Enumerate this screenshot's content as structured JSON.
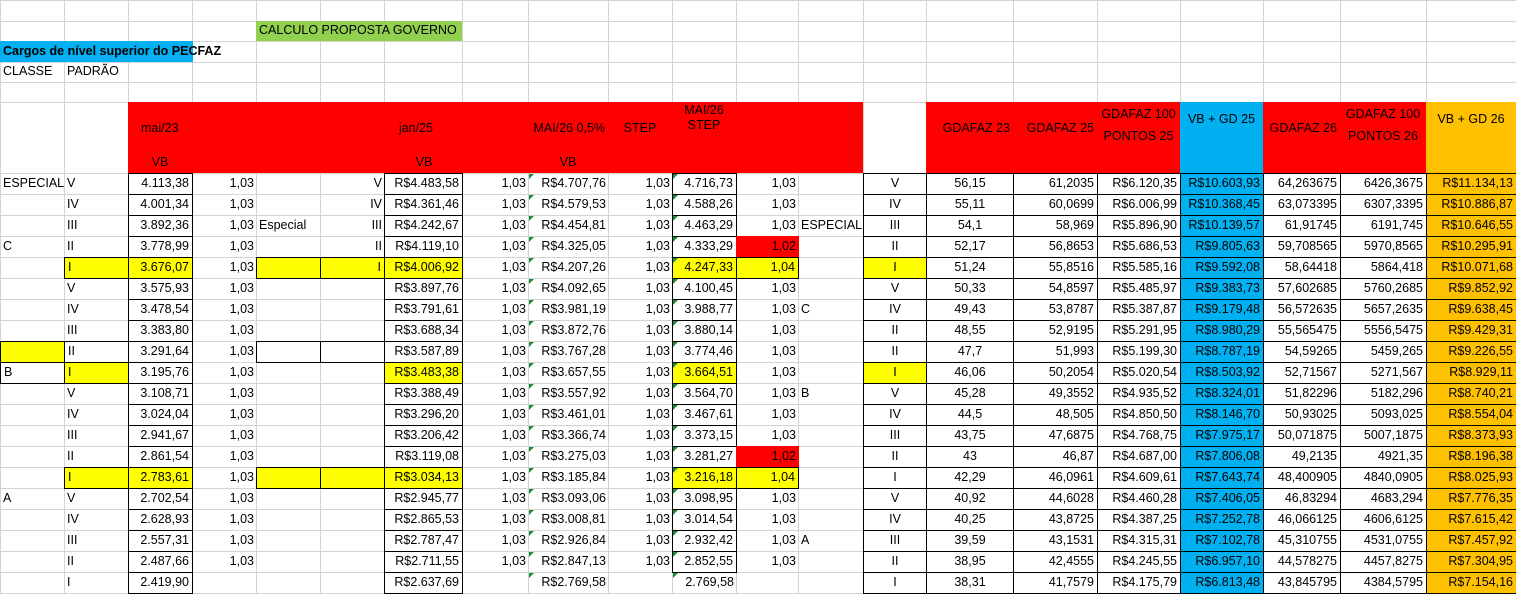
{
  "colors": {
    "red": "#ff0000",
    "yellow": "#ffff00",
    "cyan": "#00b0f0",
    "orange": "#ffc000",
    "green": "#92d050",
    "grid": "#d4d4d4"
  },
  "top": {
    "calc_title": "CALCULO PROPOSTA GOVERNO",
    "cargos": "Cargos de nível superior do PECFAZ",
    "classe": "CLASSE",
    "padrao": "PADRÃO"
  },
  "headers": {
    "mai23": "mai/23",
    "vb1": "VB",
    "jan25": "jan/25",
    "vb2": "VB",
    "mai26_05": "MAI/26 0,5%",
    "vb3": "VB",
    "step": "STEP",
    "mai26_step_1": "MAI/26",
    "mai26_step_2": "STEP",
    "gdafaz23": "GDAFAZ 23",
    "gdafaz25": "GDAFAZ 25",
    "gdafaz100_25_1": "GDAFAZ 100",
    "gdafaz100_25_2": "PONTOS 25",
    "vbgd25": "VB + GD 25",
    "gdafaz26": "GDAFAZ 26",
    "gdafaz100_26_1": "GDAFAZ 100",
    "gdafaz100_26_2": "PONTOS 26",
    "vbgd26": "VB + GD 26"
  },
  "rows": [
    {
      "classe": "ESPECIAL",
      "padrao": "V",
      "v23": "4.113,38",
      "f1": "1,03",
      "ca": "",
      "pa": "V",
      "jan25": "R$4.483,58",
      "f2": "1,03",
      "mai26": "R$4.707,76",
      "f3": "1,03",
      "step": "4.716,73",
      "f4": "1,03",
      "cb": "",
      "pb": "V",
      "g23": "56,15",
      "g25": "61,2035",
      "gp25": "R$6.120,35",
      "vb25": "R$10.603,93",
      "g26": "64,263675",
      "gp26": "6426,3675",
      "vb26": "R$11.134,13"
    },
    {
      "classe": "",
      "padrao": "IV",
      "v23": "4.001,34",
      "f1": "1,03",
      "ca": "",
      "pa": "IV",
      "jan25": "R$4.361,46",
      "f2": "1,03",
      "mai26": "R$4.579,53",
      "f3": "1,03",
      "step": "4.588,26",
      "f4": "1,03",
      "cb": "",
      "pb": "IV",
      "g23": "55,11",
      "g25": "60,0699",
      "gp25": "R$6.006,99",
      "vb25": "R$10.368,45",
      "g26": "63,073395",
      "gp26": "6307,3395",
      "vb26": "R$10.886,87"
    },
    {
      "classe": "",
      "padrao": "III",
      "v23": "3.892,36",
      "f1": "1,03",
      "ca": "Especial",
      "pa": "III",
      "jan25": "R$4.242,67",
      "f2": "1,03",
      "mai26": "R$4.454,81",
      "f3": "1,03",
      "step": "4.463,29",
      "f4": "1,03",
      "cb": "ESPECIAL",
      "pb": "III",
      "g23": "54,1",
      "g25": "58,969",
      "gp25": "R$5.896,90",
      "vb25": "R$10.139,57",
      "g26": "61,91745",
      "gp26": "6191,745",
      "vb26": "R$10.646,55"
    },
    {
      "classe": "C",
      "padrao": "II",
      "v23": "3.778,99",
      "f1": "1,03",
      "ca": "",
      "pa": "II",
      "jan25": "R$4.119,10",
      "f2": "1,03",
      "mai26": "R$4.325,05",
      "f3": "1,03",
      "step": "4.333,29",
      "f4": "1,02",
      "cb": "",
      "pb": "II",
      "g23": "52,17",
      "g25": "56,8653",
      "gp25": "R$5.686,53",
      "vb25": "R$9.805,63",
      "g26": "59,708565",
      "gp26": "5970,8565",
      "vb26": "R$10.295,91"
    },
    {
      "classe": "",
      "padrao": "I",
      "v23": "3.676,07",
      "f1": "1,03",
      "ca": "",
      "pa": "I",
      "jan25": "R$4.006,92",
      "f2": "1,03",
      "mai26": "R$4.207,26",
      "f3": "1,03",
      "step": "4.247,33",
      "f4": "1,04",
      "cb": "",
      "pb": "I",
      "g23": "51,24",
      "g25": "55,8516",
      "gp25": "R$5.585,16",
      "vb25": "R$9.592,08",
      "g26": "58,64418",
      "gp26": "5864,418",
      "vb26": "R$10.071,68"
    },
    {
      "classe": "",
      "padrao": "V",
      "v23": "3.575,93",
      "f1": "1,03",
      "ca": "",
      "pa": "",
      "jan25": "R$3.897,76",
      "f2": "1,03",
      "mai26": "R$4.092,65",
      "f3": "1,03",
      "step": "4.100,45",
      "f4": "1,03",
      "cb": "",
      "pb": "V",
      "g23": "50,33",
      "g25": "54,8597",
      "gp25": "R$5.485,97",
      "vb25": "R$9.383,73",
      "g26": "57,602685",
      "gp26": "5760,2685",
      "vb26": "R$9.852,92"
    },
    {
      "classe": "",
      "padrao": "IV",
      "v23": "3.478,54",
      "f1": "1,03",
      "ca": "",
      "pa": "",
      "jan25": "R$3.791,61",
      "f2": "1,03",
      "mai26": "R$3.981,19",
      "f3": "1,03",
      "step": "3.988,77",
      "f4": "1,03",
      "cb": "C",
      "pb": "IV",
      "g23": "49,43",
      "g25": "53,8787",
      "gp25": "R$5.387,87",
      "vb25": "R$9.179,48",
      "g26": "56,572635",
      "gp26": "5657,2635",
      "vb26": "R$9.638,45"
    },
    {
      "classe": "",
      "padrao": "III",
      "v23": "3.383,80",
      "f1": "1,03",
      "ca": "",
      "pa": "",
      "jan25": "R$3.688,34",
      "f2": "1,03",
      "mai26": "R$3.872,76",
      "f3": "1,03",
      "step": "3.880,14",
      "f4": "1,03",
      "cb": "",
      "pb": "II",
      "g23": "48,55",
      "g25": "52,9195",
      "gp25": "R$5.291,95",
      "vb25": "R$8.980,29",
      "g26": "55,565475",
      "gp26": "5556,5475",
      "vb26": "R$9.429,31"
    },
    {
      "classe": "",
      "padrao": "II",
      "v23": "3.291,64",
      "f1": "1,03",
      "ca": "",
      "pa": "",
      "jan25": "R$3.587,89",
      "f2": "1,03",
      "mai26": "R$3.767,28",
      "f3": "1,03",
      "step": "3.774,46",
      "f4": "1,03",
      "cb": "",
      "pb": "II",
      "g23": "47,7",
      "g25": "51,993",
      "gp25": "R$5.199,30",
      "vb25": "R$8.787,19",
      "g26": "54,59265",
      "gp26": "5459,265",
      "vb26": "R$9.226,55"
    },
    {
      "classe": "B",
      "padrao": "I",
      "v23": "3.195,76",
      "f1": "1,03",
      "ca": "",
      "pa": "",
      "jan25": "R$3.483,38",
      "f2": "1,03",
      "mai26": "R$3.657,55",
      "f3": "1,03",
      "step": "3.664,51",
      "f4": "1,03",
      "cb": "",
      "pb": "I",
      "g23": "46,06",
      "g25": "50,2054",
      "gp25": "R$5.020,54",
      "vb25": "R$8.503,92",
      "g26": "52,71567",
      "gp26": "5271,567",
      "vb26": "R$8.929,11"
    },
    {
      "classe": "",
      "padrao": "V",
      "v23": "3.108,71",
      "f1": "1,03",
      "ca": "",
      "pa": "",
      "jan25": "R$3.388,49",
      "f2": "1,03",
      "mai26": "R$3.557,92",
      "f3": "1,03",
      "step": "3.564,70",
      "f4": "1,03",
      "cb": "B",
      "pb": "V",
      "g23": "45,28",
      "g25": "49,3552",
      "gp25": "R$4.935,52",
      "vb25": "R$8.324,01",
      "g26": "51,82296",
      "gp26": "5182,296",
      "vb26": "R$8.740,21"
    },
    {
      "classe": "",
      "padrao": "IV",
      "v23": "3.024,04",
      "f1": "1,03",
      "ca": "",
      "pa": "",
      "jan25": "R$3.296,20",
      "f2": "1,03",
      "mai26": "R$3.461,01",
      "f3": "1,03",
      "step": "3.467,61",
      "f4": "1,03",
      "cb": "",
      "pb": "IV",
      "g23": "44,5",
      "g25": "48,505",
      "gp25": "R$4.850,50",
      "vb25": "R$8.146,70",
      "g26": "50,93025",
      "gp26": "5093,025",
      "vb26": "R$8.554,04"
    },
    {
      "classe": "",
      "padrao": "III",
      "v23": "2.941,67",
      "f1": "1,03",
      "ca": "",
      "pa": "",
      "jan25": "R$3.206,42",
      "f2": "1,03",
      "mai26": "R$3.366,74",
      "f3": "1,03",
      "step": "3.373,15",
      "f4": "1,03",
      "cb": "",
      "pb": "III",
      "g23": "43,75",
      "g25": "47,6875",
      "gp25": "R$4.768,75",
      "vb25": "R$7.975,17",
      "g26": "50,071875",
      "gp26": "5007,1875",
      "vb26": "R$8.373,93"
    },
    {
      "classe": "",
      "padrao": "II",
      "v23": "2.861,54",
      "f1": "1,03",
      "ca": "",
      "pa": "",
      "jan25": "R$3.119,08",
      "f2": "1,03",
      "mai26": "R$3.275,03",
      "f3": "1,03",
      "step": "3.281,27",
      "f4": "1,02",
      "cb": "",
      "pb": "II",
      "g23": "43",
      "g25": "46,87",
      "gp25": "R$4.687,00",
      "vb25": "R$7.806,08",
      "g26": "49,2135",
      "gp26": "4921,35",
      "vb26": "R$8.196,38"
    },
    {
      "classe": "",
      "padrao": "I",
      "v23": "2.783,61",
      "f1": "1,03",
      "ca": "",
      "pa": "",
      "jan25": "R$3.034,13",
      "f2": "1,03",
      "mai26": "R$3.185,84",
      "f3": "1,03",
      "step": "3.216,18",
      "f4": "1,04",
      "cb": "",
      "pb": "I",
      "g23": "42,29",
      "g25": "46,0961",
      "gp25": "R$4.609,61",
      "vb25": "R$7.643,74",
      "g26": "48,400905",
      "gp26": "4840,0905",
      "vb26": "R$8.025,93"
    },
    {
      "classe": "A",
      "padrao": "V",
      "v23": "2.702,54",
      "f1": "1,03",
      "ca": "",
      "pa": "",
      "jan25": "R$2.945,77",
      "f2": "1,03",
      "mai26": "R$3.093,06",
      "f3": "1,03",
      "step": "3.098,95",
      "f4": "1,03",
      "cb": "",
      "pb": "V",
      "g23": "40,92",
      "g25": "44,6028",
      "gp25": "R$4.460,28",
      "vb25": "R$7.406,05",
      "g26": "46,83294",
      "gp26": "4683,294",
      "vb26": "R$7.776,35"
    },
    {
      "classe": "",
      "padrao": "IV",
      "v23": "2.628,93",
      "f1": "1,03",
      "ca": "",
      "pa": "",
      "jan25": "R$2.865,53",
      "f2": "1,03",
      "mai26": "R$3.008,81",
      "f3": "1,03",
      "step": "3.014,54",
      "f4": "1,03",
      "cb": "",
      "pb": "IV",
      "g23": "40,25",
      "g25": "43,8725",
      "gp25": "R$4.387,25",
      "vb25": "R$7.252,78",
      "g26": "46,066125",
      "gp26": "4606,6125",
      "vb26": "R$7.615,42"
    },
    {
      "classe": "",
      "padrao": "III",
      "v23": "2.557,31",
      "f1": "1,03",
      "ca": "",
      "pa": "",
      "jan25": "R$2.787,47",
      "f2": "1,03",
      "mai26": "R$2.926,84",
      "f3": "1,03",
      "step": "2.932,42",
      "f4": "1,03",
      "cb": "A",
      "pb": "III",
      "g23": "39,59",
      "g25": "43,1531",
      "gp25": "R$4.315,31",
      "vb25": "R$7.102,78",
      "g26": "45,310755",
      "gp26": "4531,0755",
      "vb26": "R$7.457,92"
    },
    {
      "classe": "",
      "padrao": "II",
      "v23": "2.487,66",
      "f1": "1,03",
      "ca": "",
      "pa": "",
      "jan25": "R$2.711,55",
      "f2": "1,03",
      "mai26": "R$2.847,13",
      "f3": "1,03",
      "step": "2.852,55",
      "f4": "1,03",
      "cb": "",
      "pb": "II",
      "g23": "38,95",
      "g25": "42,4555",
      "gp25": "R$4.245,55",
      "vb25": "R$6.957,10",
      "g26": "44,578275",
      "gp26": "4457,8275",
      "vb26": "R$7.304,95"
    },
    {
      "classe": "",
      "padrao": "I",
      "v23": "2.419,90",
      "f1": "",
      "ca": "",
      "pa": "",
      "jan25": "R$2.637,69",
      "f2": "",
      "mai26": "R$2.769,58",
      "f3": "",
      "step": "2.769,58",
      "f4": "",
      "cb": "",
      "pb": "I",
      "g23": "38,31",
      "g25": "41,7579",
      "gp25": "R$4.175,79",
      "vb25": "R$6.813,48",
      "g26": "43,845795",
      "gp26": "4384,5795",
      "vb26": "R$7.154,16"
    }
  ]
}
